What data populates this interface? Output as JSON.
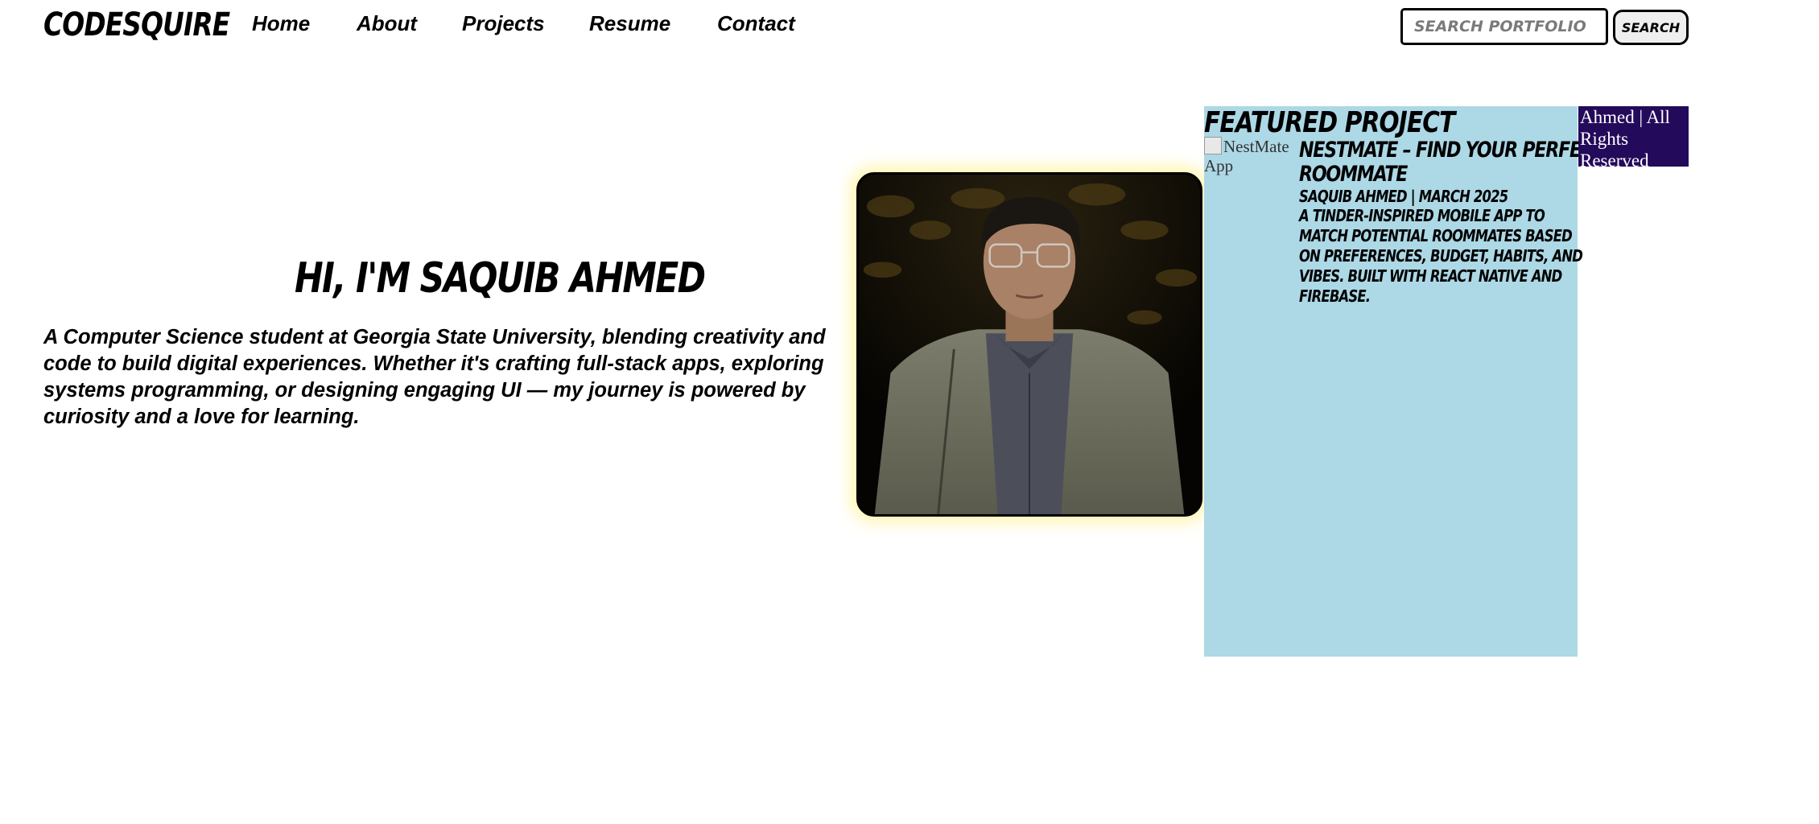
{
  "header": {
    "logo": "CodeSquire",
    "nav": [
      "Home",
      "About",
      "Projects",
      "Resume",
      "Contact"
    ],
    "search_placeholder": "Search Portfolio",
    "search_button": "Search"
  },
  "hero": {
    "title": "Hi, I'm Saquib Ahmed",
    "text": "A Computer Science student at Georgia State University, blending creativity and code to build digital experiences. Whether it's crafting full-stack apps, exploring systems programming, or designing engaging UI — my journey is powered by curiosity and a love for learning."
  },
  "featured": {
    "heading": "Featured Project",
    "image_alt": "NestMate App",
    "title_lines": [
      "NestMate – Find Your Perfect",
      "Roommate"
    ],
    "meta": "Saquib Ahmed | March 2025",
    "description_lines": [
      "A Tinder-inspired mobile app to",
      "match potential roommates based",
      "on preferences, budget, habits, and",
      "vibes. Built with React Native and",
      "Firebase."
    ]
  },
  "footer": {
    "text": "Ahmed | All Rights Reserved"
  },
  "colors": {
    "featured_bg": "#add8e6",
    "footer_bg": "#240a5a",
    "portrait_glow": "#ffee78"
  }
}
